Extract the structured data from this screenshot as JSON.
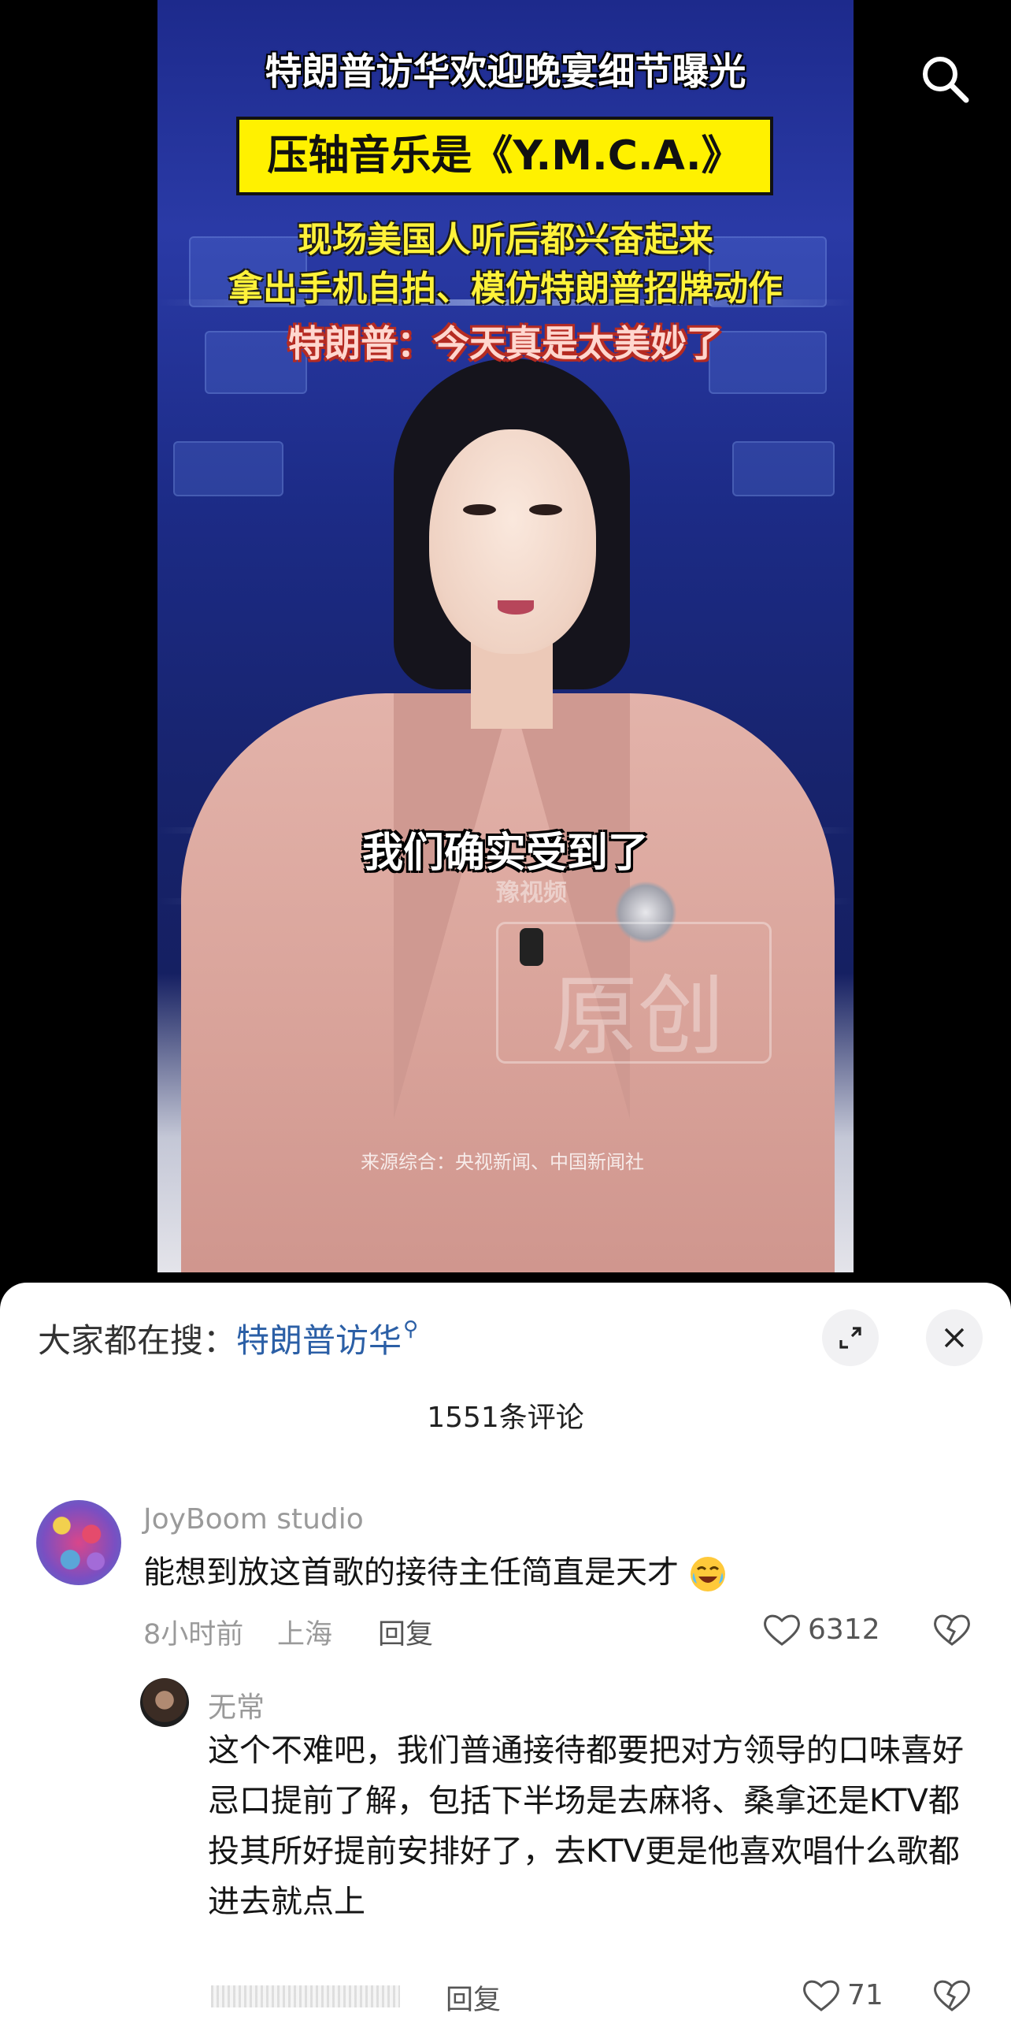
{
  "video": {
    "caption_lines": {
      "line1": "特朗普访华欢迎晚宴细节曝光",
      "line2": "压轴音乐是《Y.M.C.A.》",
      "line3": "现场美国人听后都兴奋起来",
      "line4": "拿出手机自拍、模仿特朗普招牌动作",
      "line5": "特朗普：今天真是太美妙了"
    },
    "subtitle": "我们确实受到了",
    "watermark_logo": "豫视频",
    "watermark_original": "原创",
    "source": "来源综合：央视新闻、中国新闻社"
  },
  "icons": {
    "search": "search-icon",
    "expand": "expand-icon",
    "close": "close-icon",
    "heart": "heart-icon",
    "dislike": "broken-heart-icon"
  },
  "sheet": {
    "trend_prefix": "大家都在搜：",
    "trend_term": "特朗普访华",
    "comment_count": "1551条评论"
  },
  "comments": [
    {
      "user": "JoyBoom studio",
      "text": "能想到放这首歌的接待主任简直是天才",
      "time": "8小时前",
      "location": "上海",
      "reply_label": "回复",
      "likes": "6312"
    },
    {
      "user": "无常",
      "text": "这个不难吧，我们普通接待都要把对方领导的口味喜好忌口提前了解，包括下半场是去麻将、桑拿还是KTV都投其所好提前安排好了，去KTV更是他喜欢唱什么歌都进去就点上",
      "reply_label": "回复",
      "likes": "71"
    }
  ],
  "colors": {
    "link": "#2b5fa6",
    "caption_box": "#fff100"
  }
}
